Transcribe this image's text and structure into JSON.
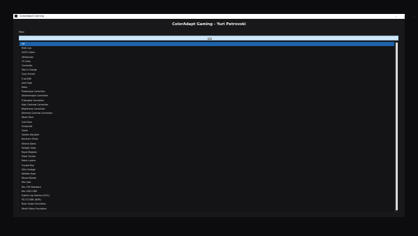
{
  "window": {
    "title": "ColorAdapt Gaming"
  },
  "header": {
    "title": "ColorAdapt Gaming - Yuri Petrovski"
  },
  "filter": {
    "label": "Filter",
    "value": ""
  },
  "list": {
    "selected_index": 0,
    "items": [
      "Off",
      "RGB Calc",
      "OLED Colors",
      "Offsetcolor",
      "TV Calm",
      "Cinematic",
      "Teal & Orange",
      "Cozy Sunset",
      "True B/W",
      "Anti-Flash",
      "Retro",
      "Protanopia Correction",
      "Deuteranopia Correction",
      "Tritanopia Correction",
      "High Contrast Correction",
      "Brightness Correction",
      "Dimmed Contrast Correction",
      "Warm Tone",
      "Cold Tone",
      "Grayscale",
      "Sepia",
      "Golden Daylight",
      "Nocturne Mono",
      "Eternal Dawn",
      "Twilight Glow",
      "Royal Majestic",
      "Silver Screen",
      "Retro Lucens",
      "Crystal Day",
      "Glitz Vintage",
      "Wildfire Heat",
      "Mauve Bjorek",
      "Film Noir",
      "Rec.709 Standard",
      "Rec.2020 HDR",
      "Hybrid Log Gamma (HLG)",
      "PQ ST.2084 (HDR)",
      "Neon Vision Emulation",
      "World Vision Emulation"
    ]
  }
}
